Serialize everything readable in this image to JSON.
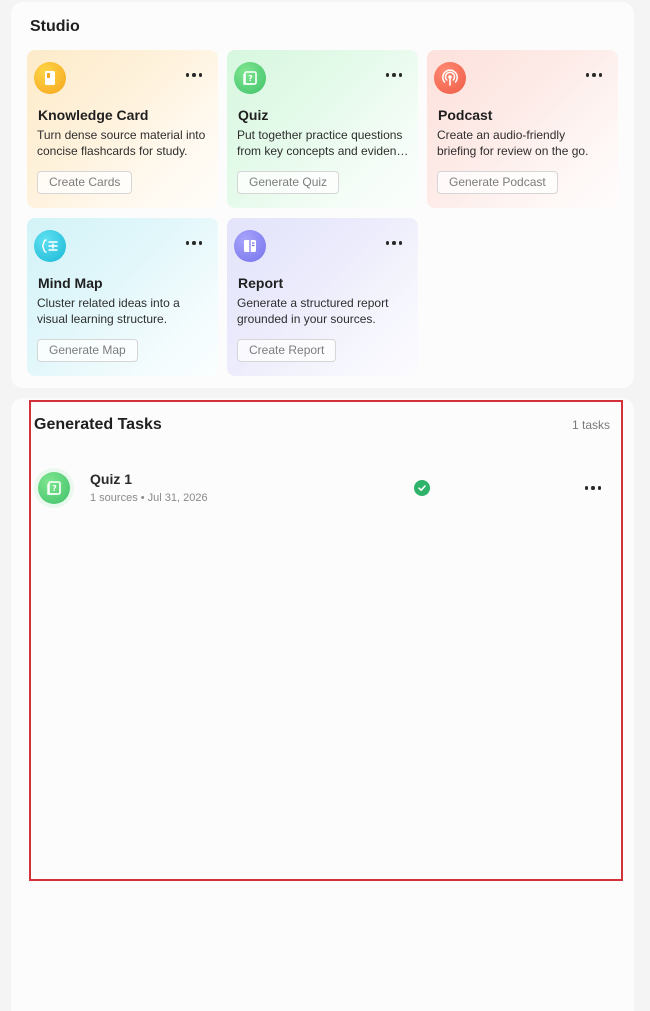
{
  "studio": {
    "title": "Studio",
    "cards": [
      {
        "id": "knowledge-card",
        "title": "Knowledge Card",
        "desc_line1": "Turn dense source material into",
        "desc_line2": "concise flashcards for study.",
        "button": "Create Cards",
        "icon": "flashcard-icon",
        "accent": "#f5a51c"
      },
      {
        "id": "quiz",
        "title": "Quiz",
        "desc_line1": "Put together practice questions",
        "desc_line2": "from key concepts and evidence.",
        "button": "Generate Quiz",
        "icon": "quiz-icon",
        "accent": "#3fc26a"
      },
      {
        "id": "podcast",
        "title": "Podcast",
        "desc_line1": "Create an audio-friendly",
        "desc_line2": "briefing for review on the go.",
        "button": "Generate Podcast",
        "icon": "podcast-icon",
        "accent": "#ef5a45"
      },
      {
        "id": "mind-map",
        "title": "Mind Map",
        "desc_line1": "Cluster related ideas into a",
        "desc_line2": "visual learning structure.",
        "button": "Generate Map",
        "icon": "mind-map-icon",
        "accent": "#1ab8d6"
      },
      {
        "id": "report",
        "title": "Report",
        "desc_line1": "Generate a structured report",
        "desc_line2": "grounded in your sources.",
        "button": "Create Report",
        "icon": "report-icon",
        "accent": "#7672ec"
      }
    ]
  },
  "tasks": {
    "title": "Generated Tasks",
    "count_label": "1 tasks",
    "items": [
      {
        "name": "Quiz 1",
        "meta": "1 sources • Jul 31, 2026",
        "status": "completed",
        "status_color": "#2fb36b",
        "icon": "quiz-icon"
      }
    ]
  }
}
